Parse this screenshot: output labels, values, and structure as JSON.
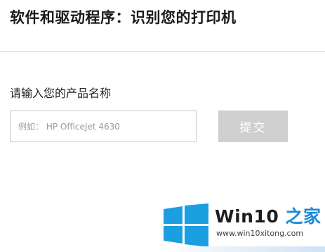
{
  "header": {
    "title": "软件和驱动程序：识别您的打印机"
  },
  "form": {
    "prompt_label": "请输入您的产品名称",
    "input_value": "",
    "input_placeholder": "例如： HP OfficeJet 4630",
    "submit_label": "提交"
  },
  "watermark": {
    "brand_prefix": "Win10",
    "brand_suffix": " 之家",
    "url": "www.win10xitong.com",
    "logo_icon": "windows-logo-icon"
  },
  "colors": {
    "button_disabled": "#cfcfcf",
    "windows_blue": "#1c9fe1",
    "brand_accent": "#1d8ad6"
  }
}
